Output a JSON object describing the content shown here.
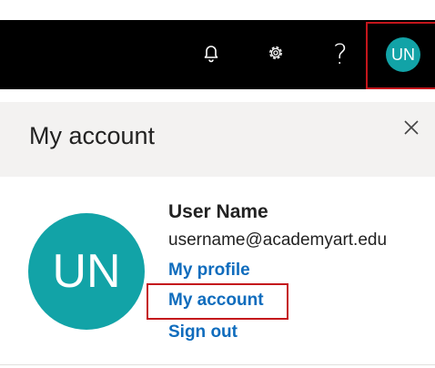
{
  "header": {
    "help_label": "?",
    "avatar_initials": "UN"
  },
  "panel": {
    "title": "My account",
    "close_glyph": "✕"
  },
  "profile": {
    "avatar_initials": "UN",
    "name": "User Name",
    "email": "username@academyart.edu",
    "links": {
      "my_profile": "My profile",
      "my_account": "My account",
      "sign_out": "Sign out"
    }
  },
  "colors": {
    "avatar_bg": "#12a3a7",
    "link": "#0f6cbd",
    "highlight": "#c4161c",
    "header_bg": "#000000",
    "panel_header_bg": "#f3f2f1"
  },
  "icons": [
    "bell-icon",
    "gear-icon",
    "help-icon",
    "close-icon"
  ]
}
